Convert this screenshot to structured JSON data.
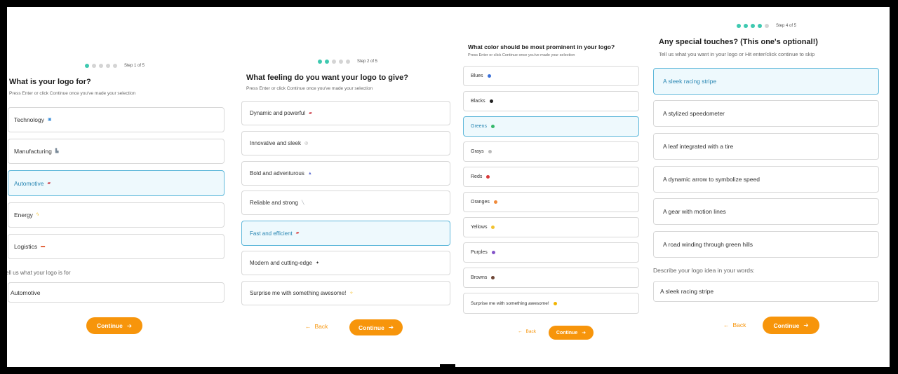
{
  "panel1": {
    "step": "Step 1 of 5",
    "title": "What is your logo for?",
    "subtitle": "Press Enter or click Continue once you've made your selection",
    "options": [
      {
        "label": "Technology",
        "icon": "computer-icon",
        "glyph": "▣",
        "color": "#3b8ed8"
      },
      {
        "label": "Manufacturing",
        "icon": "factory-icon",
        "glyph": "▙",
        "color": "#7a8a99"
      },
      {
        "label": "Automotive",
        "icon": "car-icon",
        "glyph": "▰",
        "color": "#c9303c"
      },
      {
        "label": "Energy",
        "icon": "lightning-icon",
        "glyph": "ϟ",
        "color": "#f2b400"
      },
      {
        "label": "Logistics",
        "icon": "truck-icon",
        "glyph": "▬",
        "color": "#e0552b"
      }
    ],
    "custom_label": "Tell us what your logo is for",
    "custom_value": "Automotive",
    "continue": "Continue"
  },
  "panel2": {
    "step": "Step 2 of 5",
    "title": "What feeling do you want your logo to give?",
    "subtitle": "Press Enter or click Continue once you've made your selection",
    "options": [
      {
        "label": "Dynamic and powerful",
        "icon": "car-icon",
        "glyph": "▰",
        "color": "#c9303c"
      },
      {
        "label": "Innovative and sleek",
        "icon": "sparkle-icon",
        "glyph": "◎",
        "color": "#999999"
      },
      {
        "label": "Bold and adventurous",
        "icon": "mountain-icon",
        "glyph": "▲",
        "color": "#5b6ad0"
      },
      {
        "label": "Reliable and strong",
        "icon": "wrench-icon",
        "glyph": "╲",
        "color": "#9aa0a6"
      },
      {
        "label": "Fast and efficient",
        "icon": "racecar-icon",
        "glyph": "▰",
        "color": "#d94040"
      },
      {
        "label": "Modern and cutting-edge",
        "icon": "pin-icon",
        "glyph": "✦",
        "color": "#333333"
      },
      {
        "label": "Surprise me with something awesome!",
        "icon": "sparkle-icon",
        "glyph": "✧",
        "color": "#f2b400"
      }
    ],
    "back": "Back",
    "continue": "Continue"
  },
  "panel3": {
    "title": "What color should be most prominent in your logo?",
    "subtitle": "Press Enter or click Continue once you've made your selection",
    "options": [
      {
        "label": "Blues",
        "color": "#3a6fd8"
      },
      {
        "label": "Blacks",
        "color": "#222222"
      },
      {
        "label": "Greens",
        "color": "#35b96b"
      },
      {
        "label": "Grays",
        "color": "#bbbbbb"
      },
      {
        "label": "Reds",
        "color": "#d83a3a"
      },
      {
        "label": "Oranges",
        "color": "#f08a3a"
      },
      {
        "label": "Yellows",
        "color": "#f2c230"
      },
      {
        "label": "Purples",
        "color": "#8455c9"
      },
      {
        "label": "Browns",
        "color": "#6e4636"
      },
      {
        "label": "Surprise me with something awesome!",
        "color": "#f2b400"
      }
    ],
    "back": "Back",
    "continue": "Continue"
  },
  "panel4": {
    "step": "Step 4 of 5",
    "title": "Any special touches? (This one's optional!)",
    "subtitle": "Tell us what you want in your logo or Hit enter/click continue to skip",
    "options": [
      {
        "label": "A sleek racing stripe"
      },
      {
        "label": "A stylized speedometer"
      },
      {
        "label": "A leaf integrated with a tire"
      },
      {
        "label": "A dynamic arrow to symbolize speed"
      },
      {
        "label": "A gear with motion lines"
      },
      {
        "label": "A road winding through green hills"
      }
    ],
    "custom_label": "Describe your logo idea in your words:",
    "custom_value": "A sleek racing stripe",
    "back": "Back",
    "continue": "Continue"
  },
  "colors": {
    "accent": "#f7950b",
    "progress_on": "#3ec9b0",
    "selected_border": "#5fb8da",
    "selected_bg": "#eef9fd"
  }
}
